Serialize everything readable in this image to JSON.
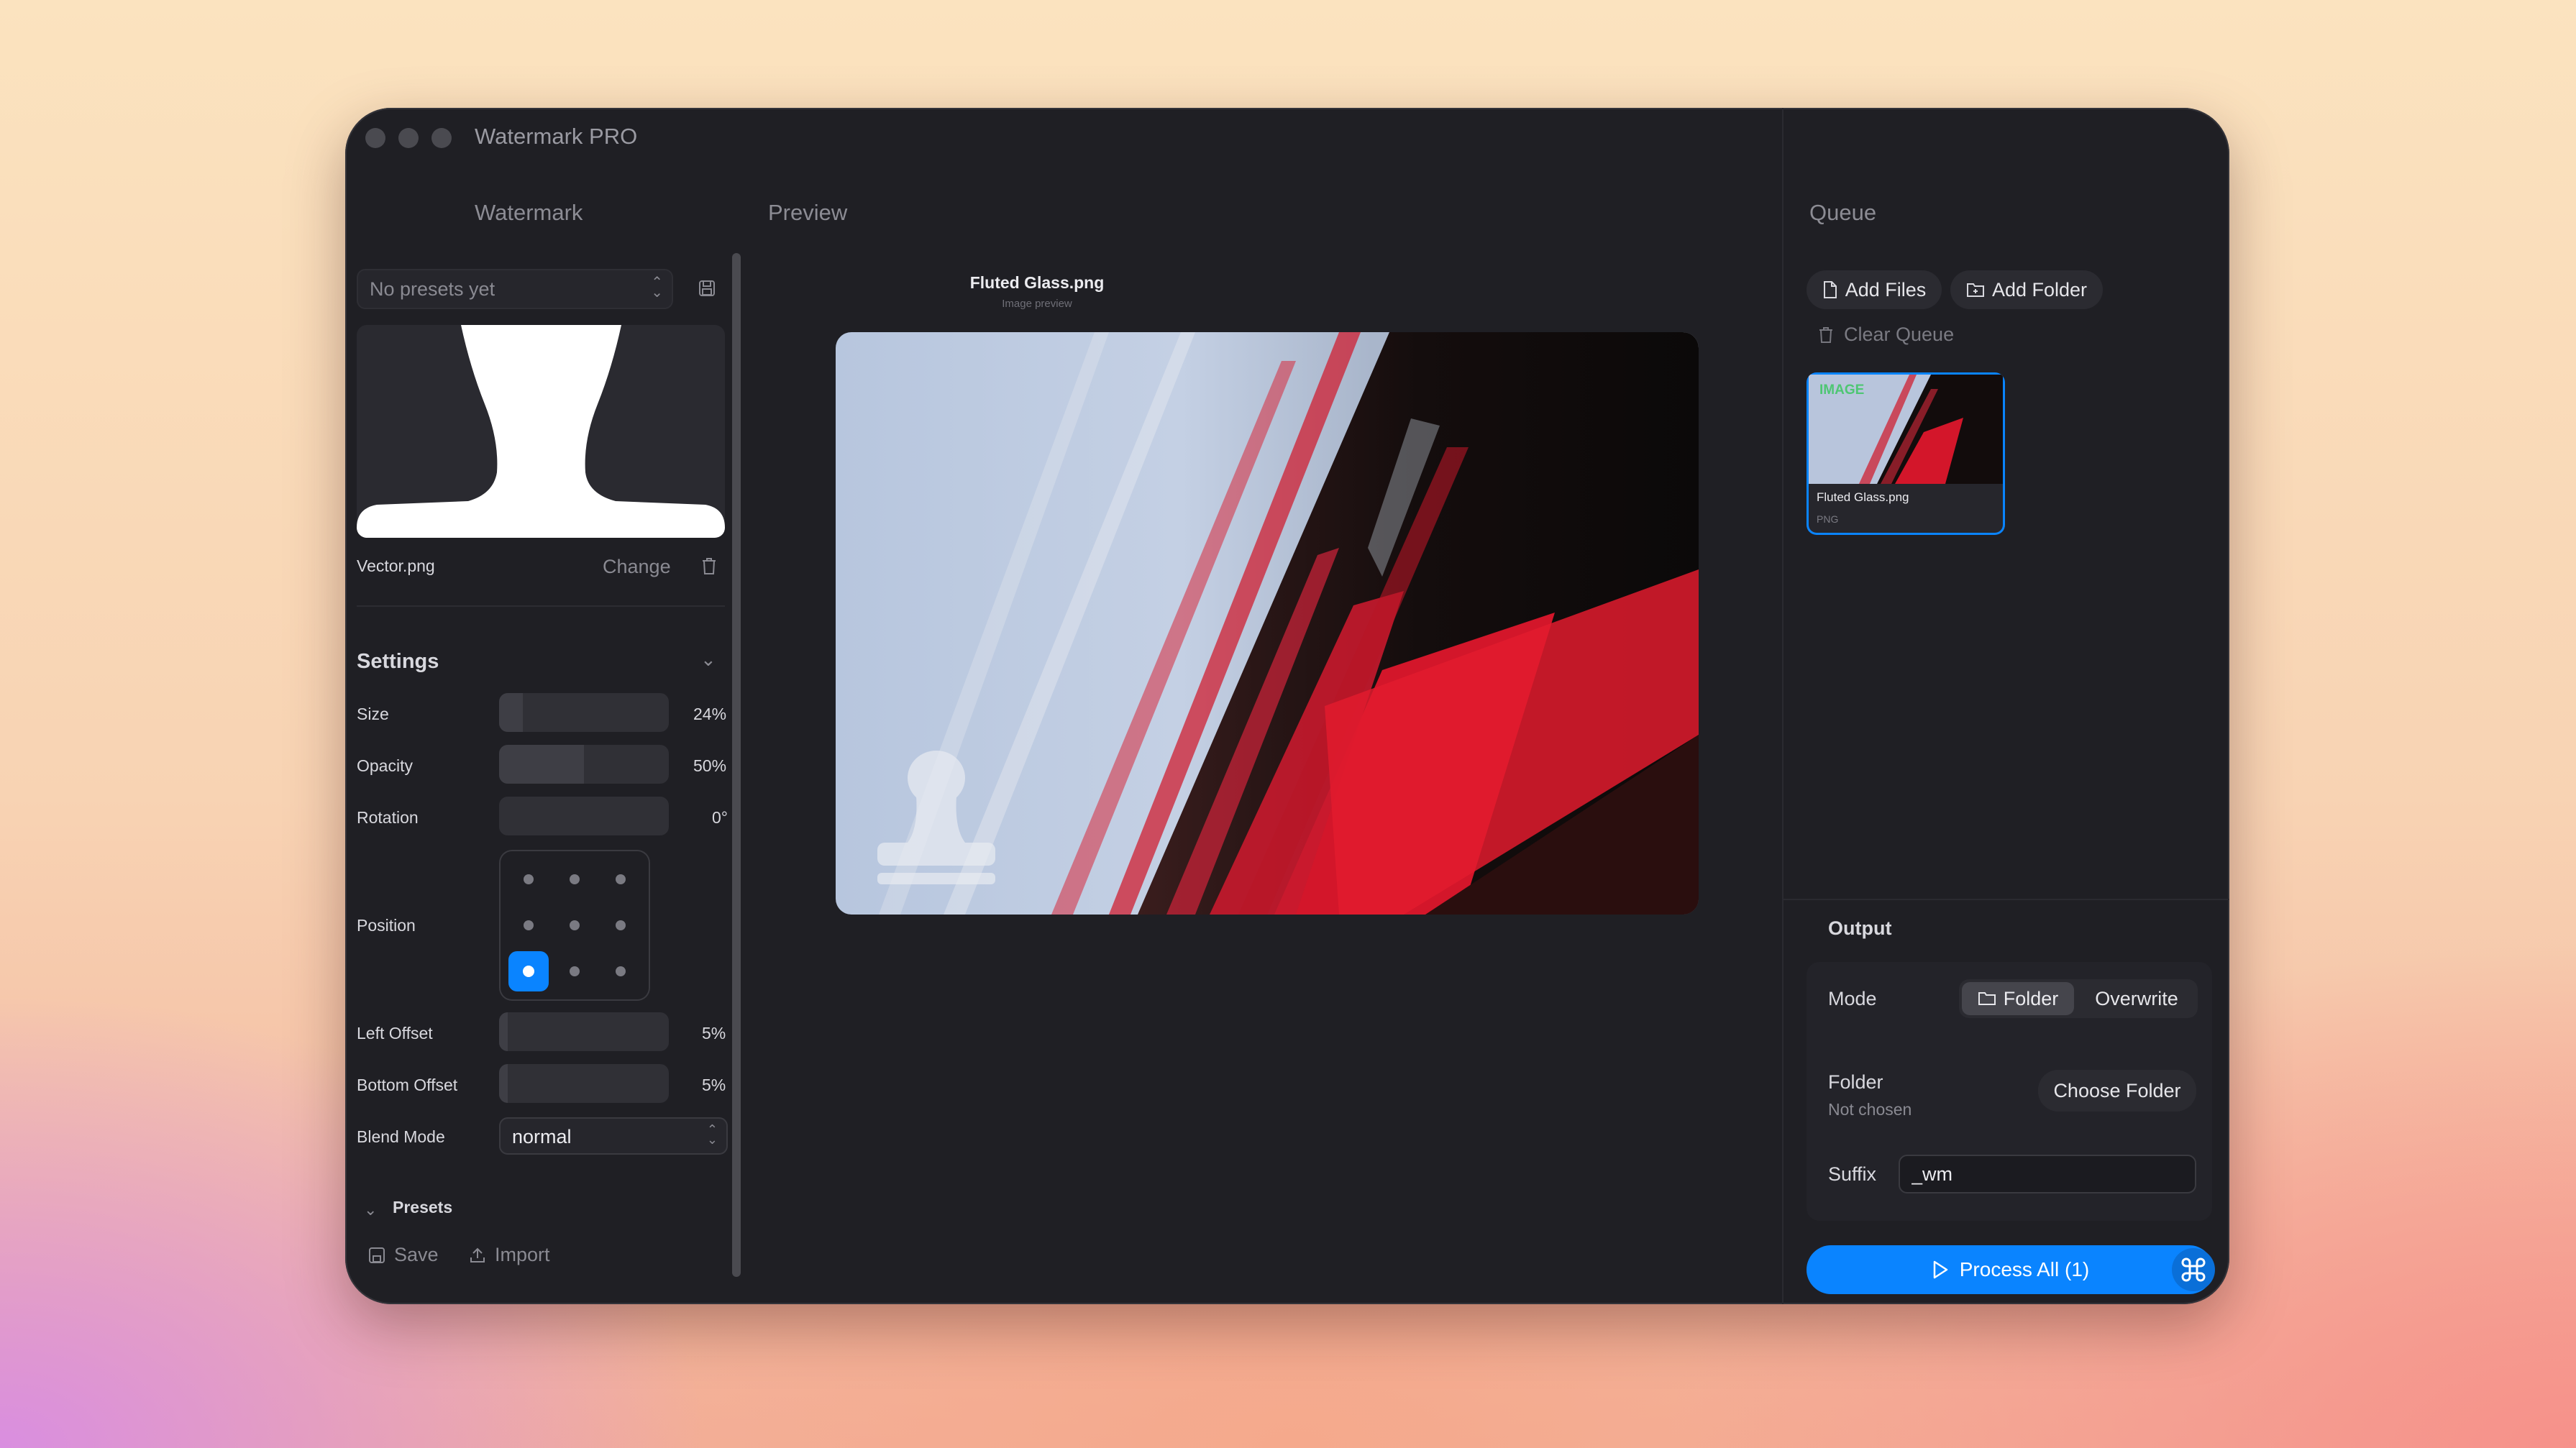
{
  "window": {
    "title": "Watermark PRO"
  },
  "left": {
    "header": "Watermark",
    "preset_select": "No presets yet",
    "watermark_file": "Vector.png",
    "change_label": "Change",
    "settings": {
      "title": "Settings",
      "size": {
        "label": "Size",
        "value": "24%",
        "level": 0.14
      },
      "opacity": {
        "label": "Opacity",
        "value": "50%",
        "level": 0.5
      },
      "rotation": {
        "label": "Rotation",
        "value": "0°",
        "level": 0.0
      },
      "position": {
        "label": "Position",
        "selected": "bottom-left"
      },
      "left_offset": {
        "label": "Left Offset",
        "value": "5%",
        "level": 0.05
      },
      "bottom_offset": {
        "label": "Bottom Offset",
        "value": "5%",
        "level": 0.05
      },
      "blend_mode": {
        "label": "Blend Mode",
        "value": "normal"
      }
    },
    "presets": {
      "title": "Presets",
      "save_label": "Save",
      "import_label": "Import"
    }
  },
  "center": {
    "header": "Preview",
    "filename": "Fluted Glass.png",
    "subtitle": "Image preview"
  },
  "right": {
    "header": "Queue",
    "add_files": "Add Files",
    "add_folder": "Add Folder",
    "clear_queue": "Clear Queue",
    "queue_items": [
      {
        "badge": "IMAGE",
        "name": "Fluted Glass.png",
        "type": "PNG"
      }
    ],
    "output": {
      "title": "Output",
      "mode_label": "Mode",
      "mode_options": [
        "Folder",
        "Overwrite"
      ],
      "mode_selected": "Folder",
      "folder_label": "Folder",
      "folder_value": "Not chosen",
      "choose_folder": "Choose Folder",
      "suffix_label": "Suffix",
      "suffix_value": "_wm"
    },
    "process_button": "Process All (1)"
  },
  "colors": {
    "accent": "#0a84ff",
    "badge": "#34c759",
    "panel": "#1f1f24"
  }
}
